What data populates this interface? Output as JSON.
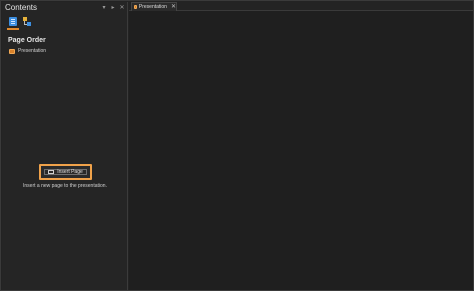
{
  "panel": {
    "title": "Contents",
    "controls": [
      "▾",
      "▸",
      "✕"
    ],
    "section_title": "Page Order",
    "tree_items": [
      "Presentation"
    ],
    "insert_button_label": "Insert Page",
    "hint_text": "Insert a new page to the presentation."
  },
  "document": {
    "tabs": [
      {
        "label": "Presentation",
        "close": "✕"
      }
    ]
  },
  "colors": {
    "accent": "#e08a2e",
    "highlight": "#f0a24a",
    "background": "#1f1f1f"
  }
}
